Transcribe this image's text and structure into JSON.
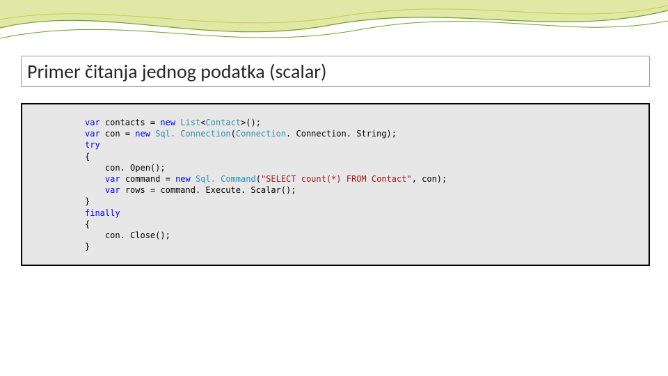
{
  "title": "Primer čitanja jednog podatka (scalar)",
  "code": {
    "var": "var",
    "new": "new",
    "try": "try",
    "finally": "finally",
    "List": "List",
    "Contact": "Contact",
    "SqlConnection": "Sql. Connection",
    "Connection": "Connection",
    "SqlCommand": "Sql. Command",
    "str_select": "\"SELECT count(*) FROM Contact\"",
    "contacts_eq": " contacts = ",
    "angle_open": "<",
    "angle_close": ">();",
    "con_eq": " con = ",
    "paren_open": "(",
    "dot_connstring": ". Connection. String);",
    "brace_open": "{",
    "brace_close": "}",
    "con_open": "    con. Open();",
    "sp4": "    ",
    "command_eq": " command = ",
    "after_str": ", con);",
    "rows_eq": " rows = command. Execute. Scalar();",
    "con_close": "    con. Close();"
  }
}
